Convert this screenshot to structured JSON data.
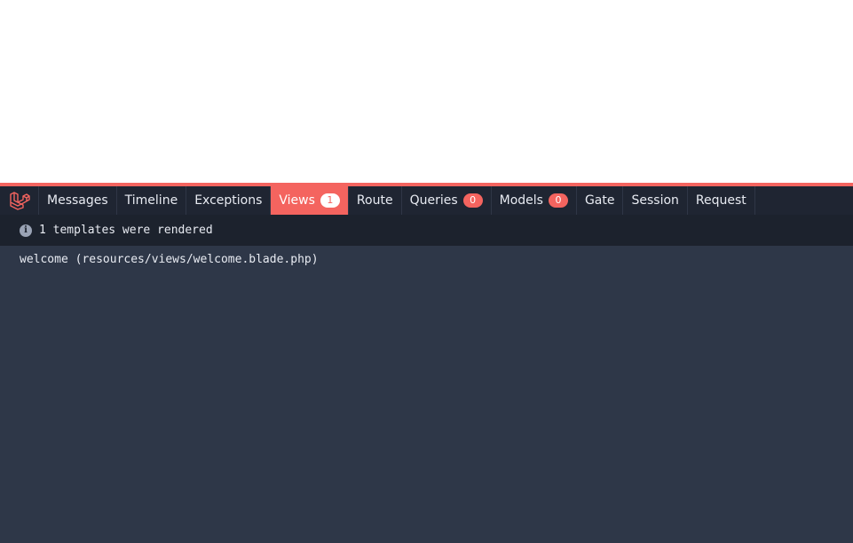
{
  "tabs": [
    {
      "label": "Messages"
    },
    {
      "label": "Timeline"
    },
    {
      "label": "Exceptions"
    },
    {
      "label": "Views",
      "badge": "1",
      "active": true
    },
    {
      "label": "Route"
    },
    {
      "label": "Queries",
      "badge": "0"
    },
    {
      "label": "Models",
      "badge": "0"
    },
    {
      "label": "Gate"
    },
    {
      "label": "Session"
    },
    {
      "label": "Request"
    }
  ],
  "status": {
    "icon": "info-icon",
    "text": "1 templates were rendered"
  },
  "views": [
    {
      "text": "welcome (resources/views/welcome.blade.php)"
    }
  ],
  "colors": {
    "accent": "#f4645f",
    "tabbar_bg": "#1f2532",
    "panel_bg": "#2e3748",
    "status_bg": "#1c222d"
  },
  "logo": {
    "icon": "laravel-logo-icon"
  }
}
